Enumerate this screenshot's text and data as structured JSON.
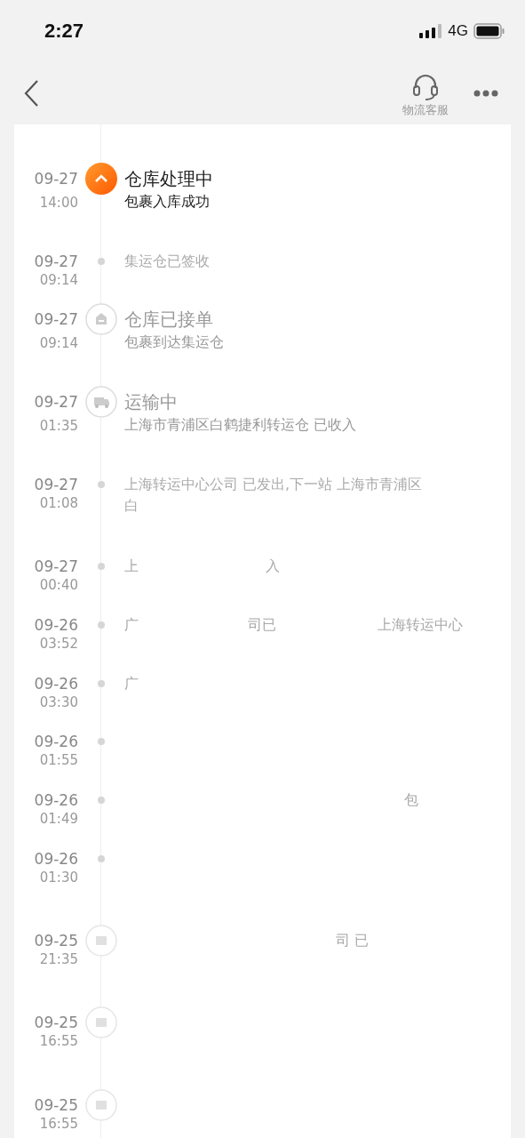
{
  "status_bar": {
    "time": "2:27",
    "network": "4G"
  },
  "nav": {
    "service_label": "物流客服"
  },
  "timeline": [
    {
      "kind": "current",
      "date": "09-27",
      "time": "14:00",
      "title": "仓库处理中",
      "lines": [
        [
          "包裹入库成功"
        ]
      ]
    },
    {
      "kind": "dot",
      "date": "09-27",
      "time": "09:14",
      "lines": [
        [
          "集运仓已签收"
        ]
      ]
    },
    {
      "kind": "warehouse",
      "date": "09-27",
      "time": "09:14",
      "title": "仓库已接单",
      "lines": [
        [
          "包裹到达集运仓"
        ]
      ]
    },
    {
      "kind": "truck",
      "date": "09-27",
      "time": "01:35",
      "title": "运输中",
      "lines": [
        [
          "上海市青浦区白鹤捷利转运仓 已收入"
        ]
      ]
    },
    {
      "kind": "dot",
      "date": "09-27",
      "time": "01:08",
      "lines": [
        [
          "上海转运中心公司 已发出,下一站 上海市青浦区"
        ],
        [
          "白"
        ]
      ]
    },
    {
      "kind": "dot",
      "date": "09-27",
      "time": "00:40",
      "lines": [
        [
          "上",
          "入"
        ]
      ]
    },
    {
      "kind": "dot",
      "date": "09-26",
      "time": "03:52",
      "lines": [
        [
          "广",
          "司已",
          "上海转运中心"
        ]
      ]
    },
    {
      "kind": "dot",
      "date": "09-26",
      "time": "03:30",
      "lines": [
        [
          "广"
        ]
      ]
    },
    {
      "kind": "dot",
      "date": "09-26",
      "time": "01:55"
    },
    {
      "kind": "dot",
      "date": "09-26",
      "time": "01:49",
      "lines": [
        [
          "包"
        ]
      ]
    },
    {
      "kind": "dot",
      "date": "09-26",
      "time": "01:30"
    },
    {
      "kind": "box",
      "date": "09-25",
      "time": "21:35",
      "lines": [
        [
          "司 已"
        ]
      ]
    },
    {
      "kind": "box",
      "date": "09-25",
      "time": "16:55"
    },
    {
      "kind": "box",
      "date": "09-25",
      "time": "16:55"
    }
  ]
}
